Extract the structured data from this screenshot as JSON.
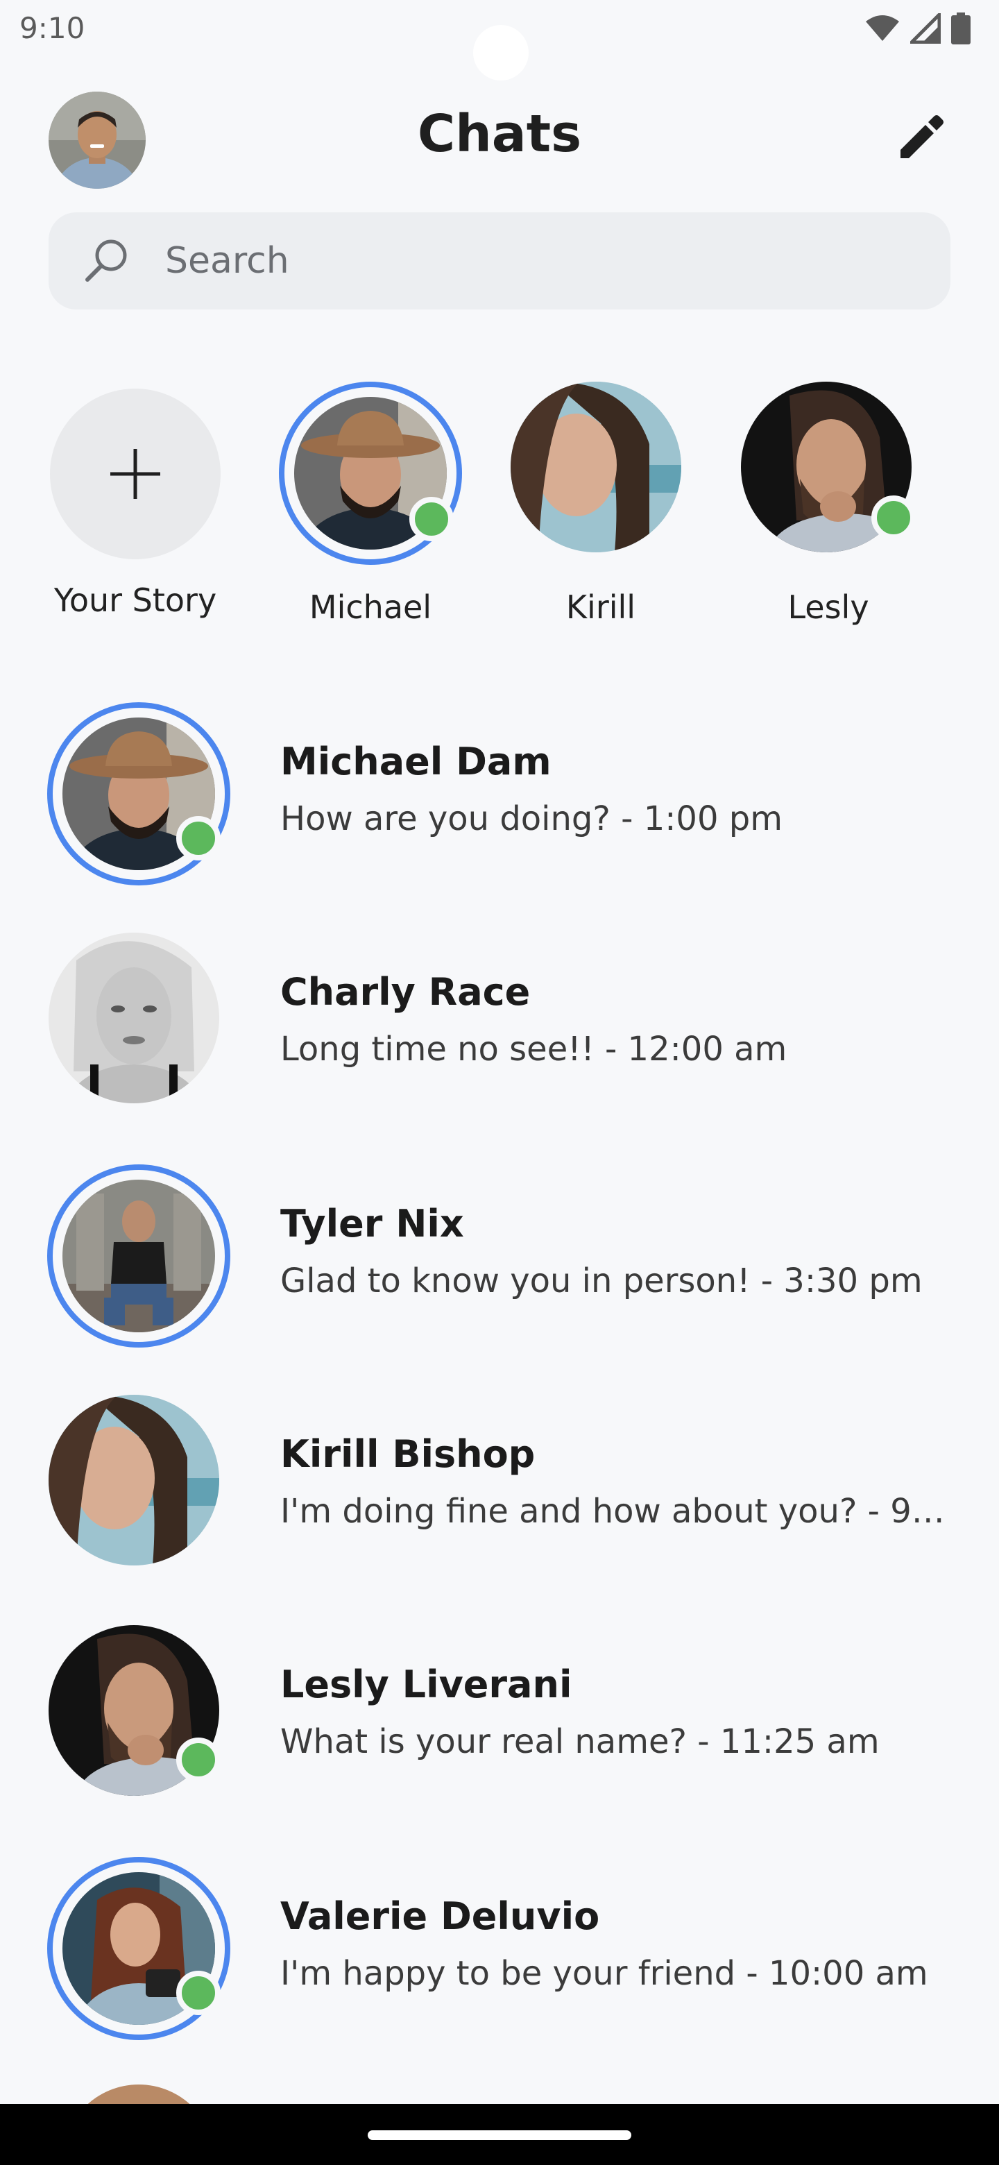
{
  "status_bar": {
    "time": "9:10"
  },
  "header": {
    "title": "Chats"
  },
  "search": {
    "placeholder": "Search"
  },
  "stories": [
    {
      "label": "Your Story"
    },
    {
      "label": "Michael"
    },
    {
      "label": "Kirill"
    },
    {
      "label": "Lesly"
    }
  ],
  "chats": [
    {
      "name": "Michael Dam",
      "preview": "How are you doing? - 1:00 pm"
    },
    {
      "name": "Charly Race",
      "preview": "Long time no see!! - 12:00 am"
    },
    {
      "name": "Tyler Nix",
      "preview": "Glad to know you in person! - 3:30 pm"
    },
    {
      "name": "Kirill Bishop",
      "preview": "I'm doing fine and how about you? - 9:0…"
    },
    {
      "name": "Lesly Liverani",
      "preview": "What is your real name? - 11:25 am"
    },
    {
      "name": "Valerie Deluvio",
      "preview": "I'm happy to be your friend - 10:00 am"
    }
  ],
  "colors": {
    "accent": "#4c86ee",
    "online": "#5cb85c",
    "background": "#f7f8fa"
  },
  "icons": [
    "avatar",
    "compose-icon",
    "search-icon",
    "plus-icon",
    "wifi-icon",
    "signal-icon",
    "battery-icon"
  ]
}
